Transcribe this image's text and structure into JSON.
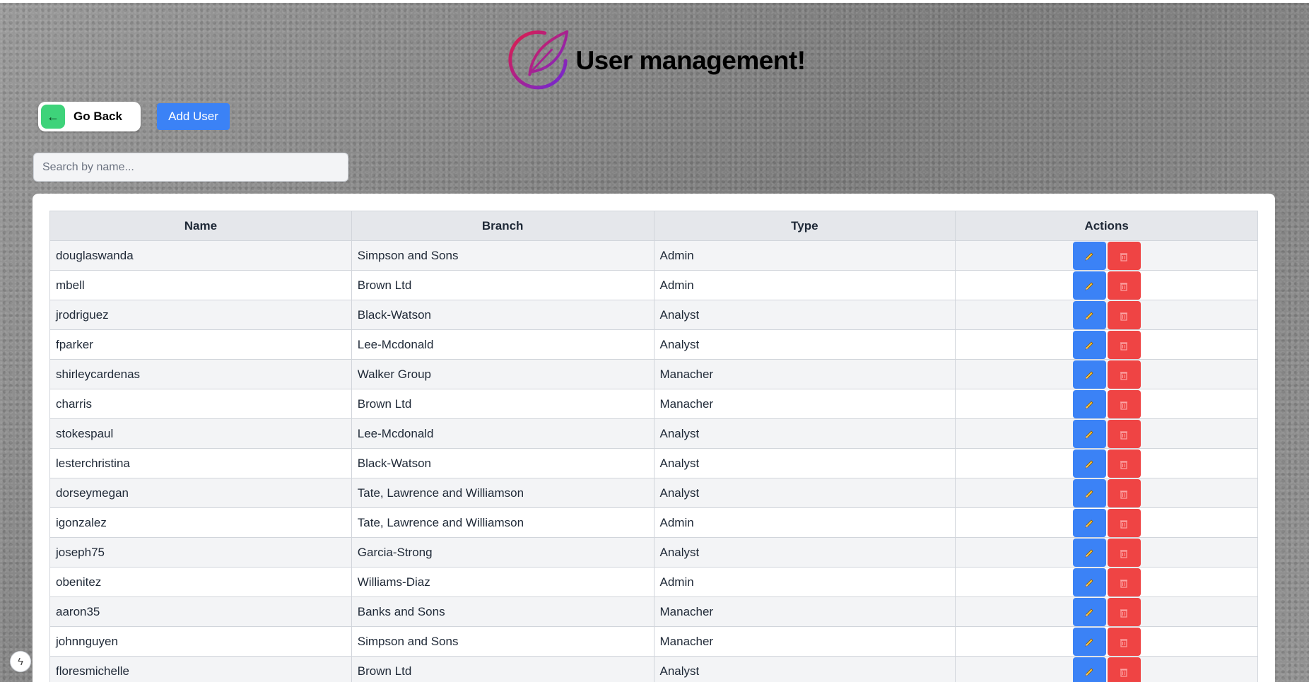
{
  "header": {
    "title": "User management!"
  },
  "toolbar": {
    "go_back_label": "Go Back",
    "add_user_label": "Add User"
  },
  "search": {
    "placeholder": "Search by name...",
    "value": ""
  },
  "table": {
    "columns": [
      "Name",
      "Branch",
      "Type",
      "Actions"
    ],
    "rows": [
      {
        "name": "douglaswanda",
        "branch": "Simpson and Sons",
        "type": "Admin"
      },
      {
        "name": "mbell",
        "branch": "Brown Ltd",
        "type": "Admin"
      },
      {
        "name": "jrodriguez",
        "branch": "Black-Watson",
        "type": "Analyst"
      },
      {
        "name": "fparker",
        "branch": "Lee-Mcdonald",
        "type": "Analyst"
      },
      {
        "name": "shirleycardenas",
        "branch": "Walker Group",
        "type": "Manacher"
      },
      {
        "name": "charris",
        "branch": "Brown Ltd",
        "type": "Manacher"
      },
      {
        "name": "stokespaul",
        "branch": "Lee-Mcdonald",
        "type": "Analyst"
      },
      {
        "name": "lesterchristina",
        "branch": "Black-Watson",
        "type": "Analyst"
      },
      {
        "name": "dorseymegan",
        "branch": "Tate, Lawrence and Williamson",
        "type": "Analyst"
      },
      {
        "name": "igonzalez",
        "branch": "Tate, Lawrence and Williamson",
        "type": "Admin"
      },
      {
        "name": "joseph75",
        "branch": "Garcia-Strong",
        "type": "Analyst"
      },
      {
        "name": "obenitez",
        "branch": "Williams-Diaz",
        "type": "Admin"
      },
      {
        "name": "aaron35",
        "branch": "Banks and Sons",
        "type": "Manacher"
      },
      {
        "name": "johnnguyen",
        "branch": "Simpson and Sons",
        "type": "Manacher"
      },
      {
        "name": "floresmichelle",
        "branch": "Brown Ltd",
        "type": "Analyst"
      }
    ],
    "edit_icon": "pencil-icon",
    "delete_icon": "trash-icon"
  },
  "colors": {
    "accent": "#3b82f6",
    "danger": "#ef4444",
    "success": "#3ed37a"
  }
}
